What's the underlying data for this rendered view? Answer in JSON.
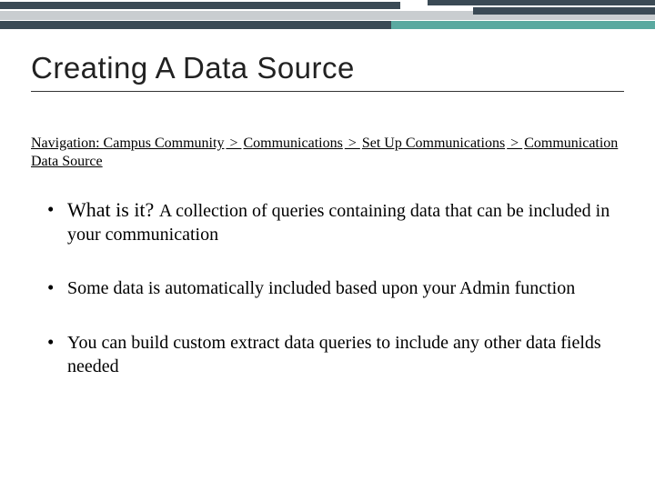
{
  "title": "Creating A Data Source",
  "navigation": {
    "label": "Navigation:",
    "parts": [
      "Campus Community",
      "Communications",
      "Set Up Communications",
      "Communication Data Source"
    ],
    "sep": ">"
  },
  "bullets": [
    {
      "lead": "What is it? ",
      "rest": "A collection of queries containing data that can be included in your communication"
    },
    {
      "lead": "",
      "rest": "Some data is automatically included based upon your Admin function"
    },
    {
      "lead": "",
      "rest": "You can build custom extract data queries to include any other data fields needed"
    }
  ]
}
